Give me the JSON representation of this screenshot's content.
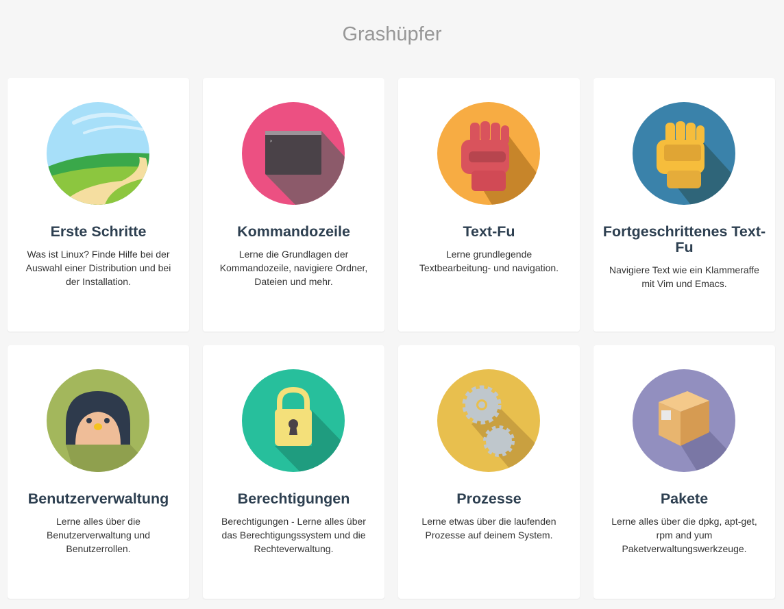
{
  "page": {
    "title": "Grashüpfer"
  },
  "cards": [
    {
      "title": "Erste Schritte",
      "description": "Was ist Linux? Finde Hilfe bei der Auswahl einer Distribution und bei der Installation.",
      "icon": "landscape-icon",
      "color": "#a7dff9"
    },
    {
      "title": "Kommandozeile",
      "description": "Lerne die Grundlagen der Kommandozeile, navigiere Ordner, Dateien und mehr.",
      "icon": "terminal-icon",
      "color": "#ec5082"
    },
    {
      "title": "Text-Fu",
      "description": "Lerne grundlegende Textbearbeitung- und navigation.",
      "icon": "fist-icon",
      "color": "#f7ac43"
    },
    {
      "title": "Fortgeschrittenes Text-Fu",
      "description": "Navigiere Text wie ein Klammeraffe mit Vim und Emacs.",
      "icon": "gloved-fist-icon",
      "color": "#3a82aa"
    },
    {
      "title": "Benutzerverwaltung",
      "description": "Lerne alles über die Benutzerverwaltung und Benutzerrollen.",
      "icon": "penguin-icon",
      "color": "#a3b75c"
    },
    {
      "title": "Berechtigungen",
      "description": "Berechtigungen - Lerne alles über das Berechtigungssystem und die Rechteverwaltung.",
      "icon": "padlock-icon",
      "color": "#27bf9c"
    },
    {
      "title": "Prozesse",
      "description": "Lerne etwas über die laufenden Prozesse auf deinem System.",
      "icon": "gears-icon",
      "color": "#e8bf4e"
    },
    {
      "title": "Pakete",
      "description": "Lerne alles über die dpkg, apt-get, rpm and yum Paketverwaltungswerkzeuge.",
      "icon": "package-box-icon",
      "color": "#928fbf"
    }
  ]
}
